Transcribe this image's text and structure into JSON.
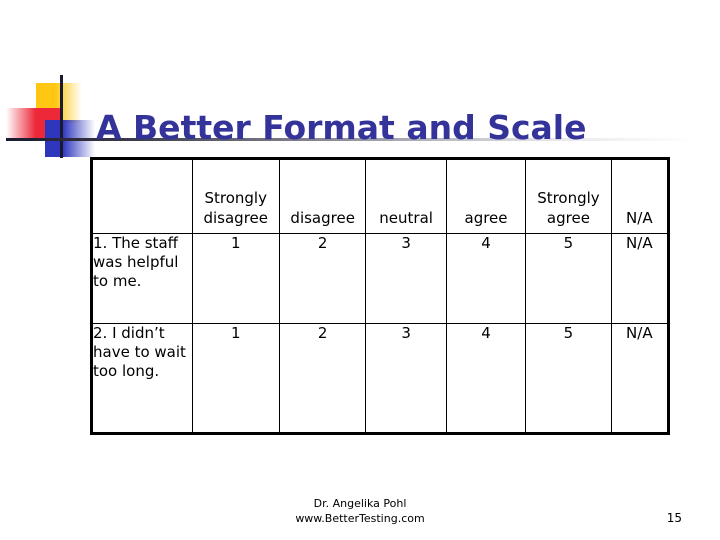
{
  "slide": {
    "title": "A Better Format and Scale",
    "title_color": "#333399",
    "page_number": "15"
  },
  "logo": {
    "square_yellow_color": "#FFC711",
    "square_red_color": "#ED2839",
    "square_blue_color": "#2E36BE",
    "rule_color": "#1A1A2E"
  },
  "table": {
    "headers": [
      "",
      "Strongly disagree",
      "disagree",
      "neutral",
      "agree",
      "Strongly agree",
      "N/A"
    ],
    "rows": [
      {
        "item": "1. The staff was helpful to me.",
        "values": [
          "1",
          "2",
          "3",
          "4",
          "5"
        ],
        "na": "N/A"
      },
      {
        "item": "2. I didn’t have to wait too long.",
        "values": [
          "1",
          "2",
          "3",
          "4",
          "5"
        ],
        "na": "N/A"
      }
    ]
  },
  "footer": {
    "author": "Dr. Angelika Pohl",
    "website": "www.BetterTesting.com"
  }
}
